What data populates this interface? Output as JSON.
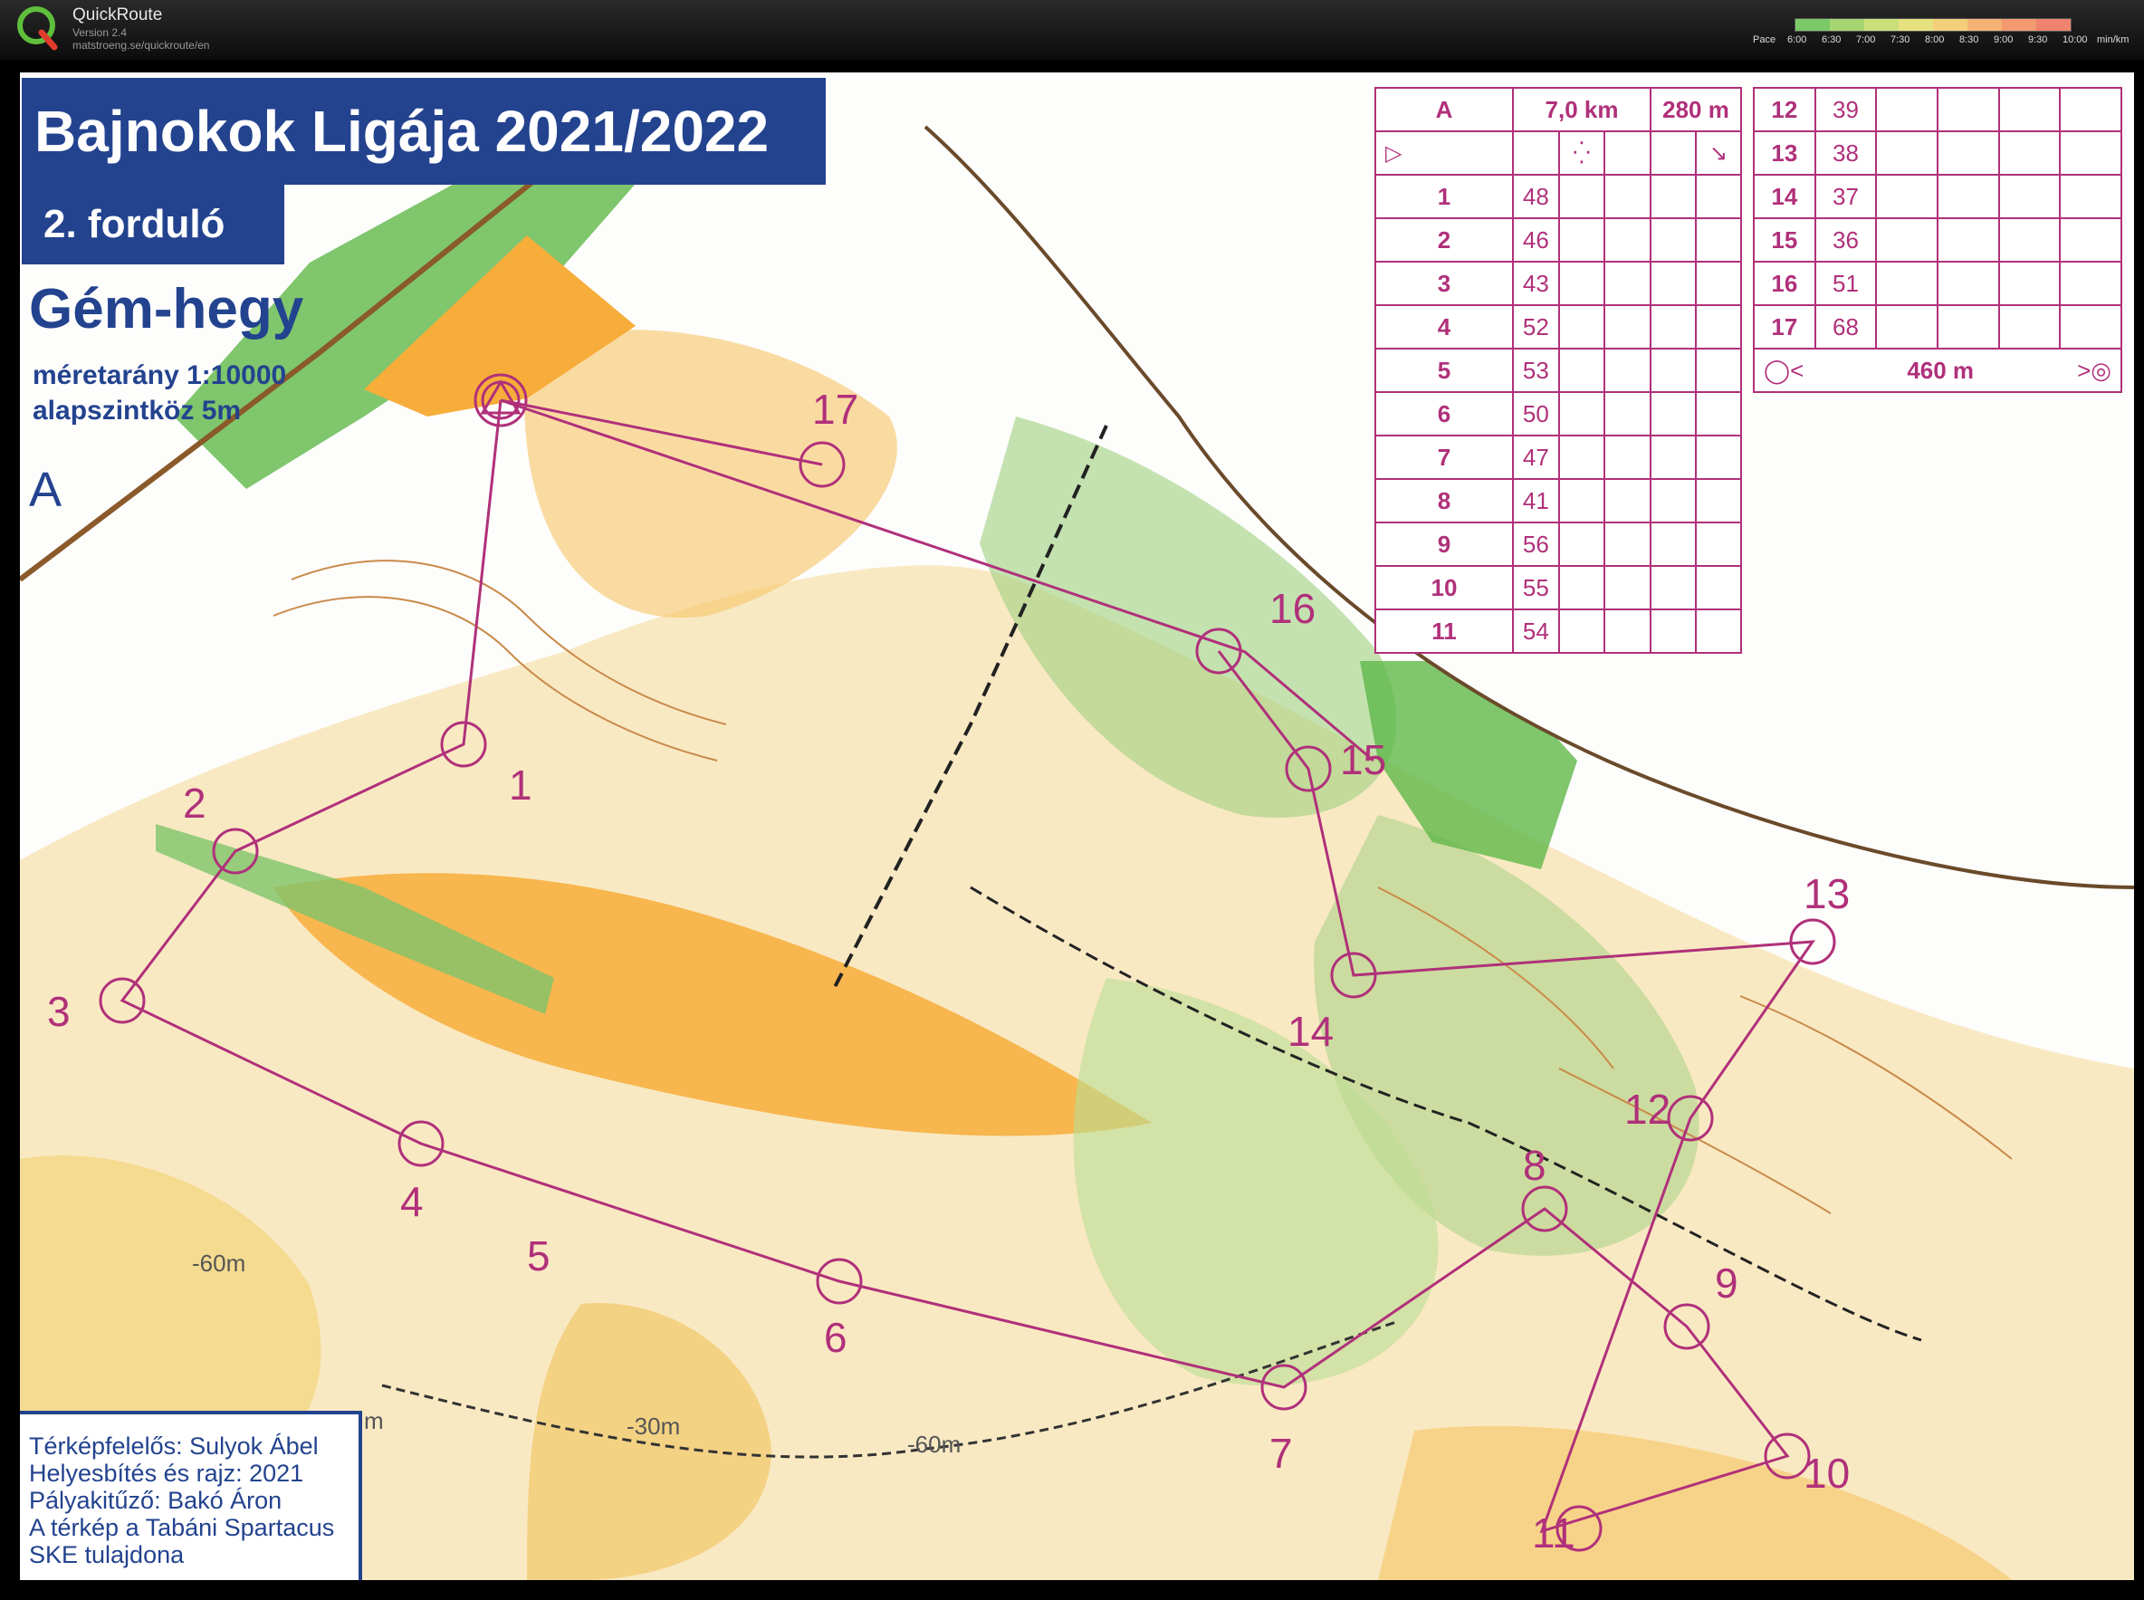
{
  "app": {
    "name": "QuickRoute",
    "version": "Version 2.4",
    "url": "matstroeng.se/quickroute/en",
    "logo_letter": "Q"
  },
  "pace_legend": {
    "label": "Pace",
    "ticks": [
      "6:00",
      "6:30",
      "7:00",
      "7:30",
      "8:00",
      "8:30",
      "9:00",
      "9:30",
      "10:00",
      "min/km"
    ],
    "colors": [
      "#7cc96a",
      "#a6d673",
      "#cbe07b",
      "#e6e27f",
      "#f3cf7a",
      "#f4b373",
      "#f39a70",
      "#f0836f"
    ]
  },
  "map": {
    "event_title": "Bajnokok Ligája 2021/2022",
    "round": "2. forduló",
    "name": "Gém-hegy",
    "scale": "méretarány 1:10000",
    "contour": "alapszintköz 5m",
    "course": "A",
    "credits": [
      "Térképfelelős: Sulyok Ábel",
      "Helyesbítés és rajz: 2021",
      "Pályakitűző: Bakó Áron",
      "A térkép a Tabáni Spartacus",
      "SKE tulajdona"
    ],
    "spot_heights": [
      "-60m",
      "-30m",
      "-60m",
      "m"
    ],
    "controls": [
      "1",
      "2",
      "3",
      "4",
      "5",
      "6",
      "7",
      "8",
      "9",
      "10",
      "11",
      "12",
      "13",
      "14",
      "15",
      "16",
      "17"
    ],
    "colors": {
      "course": "#b0307a",
      "label_blue": "#23438f",
      "open": "#f7ad3a",
      "forest_green": "#6cc04a"
    }
  },
  "description_sheet": {
    "header": {
      "course": "A",
      "length": "7,0 km",
      "climb": "280 m"
    },
    "rows_left": [
      {
        "n": "1",
        "code": "48"
      },
      {
        "n": "2",
        "code": "46"
      },
      {
        "n": "3",
        "code": "43"
      },
      {
        "n": "4",
        "code": "52"
      },
      {
        "n": "5",
        "code": "53"
      },
      {
        "n": "6",
        "code": "50"
      },
      {
        "n": "7",
        "code": "47"
      },
      {
        "n": "8",
        "code": "41"
      },
      {
        "n": "9",
        "code": "56"
      },
      {
        "n": "10",
        "code": "55"
      },
      {
        "n": "11",
        "code": "54"
      }
    ],
    "rows_right": [
      {
        "n": "12",
        "code": "39"
      },
      {
        "n": "13",
        "code": "38"
      },
      {
        "n": "14",
        "code": "37"
      },
      {
        "n": "15",
        "code": "36"
      },
      {
        "n": "16",
        "code": "51"
      },
      {
        "n": "17",
        "code": "68"
      }
    ],
    "finish_distance": "460 m"
  }
}
